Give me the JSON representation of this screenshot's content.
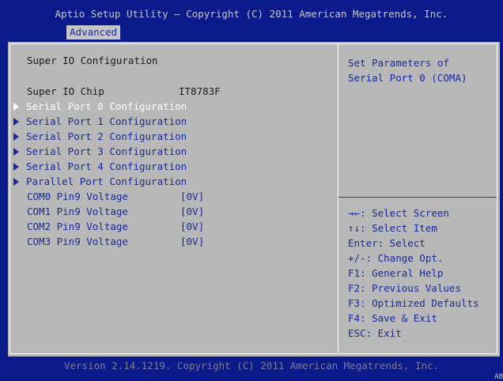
{
  "header": {
    "title": "Aptio Setup Utility – Copyright (C) 2011 American Megatrends, Inc.",
    "tab": "Advanced"
  },
  "main": {
    "title": "Super IO Configuration",
    "chip_label": "Super IO Chip",
    "chip_value": "IT8783F",
    "menu_items": [
      "Serial Port 0 Configuration",
      "Serial Port 1 Configuration",
      "Serial Port 2 Configuration",
      "Serial Port 3 Configuration",
      "Serial Port 4 Configuration",
      "Parallel Port Configuration"
    ],
    "settings": [
      {
        "label": "COM0 Pin9 Voltage",
        "value": "[0V]"
      },
      {
        "label": "COM1 Pin9 Voltage",
        "value": "[0V]"
      },
      {
        "label": "COM2 Pin9 Voltage",
        "value": "[0V]"
      },
      {
        "label": "COM3 Pin9 Voltage",
        "value": "[0V]"
      }
    ]
  },
  "help": {
    "lines": [
      "Set Parameters of",
      "Serial Port 0 (COMA)"
    ]
  },
  "keys": [
    "→←: Select Screen",
    "↑↓: Select Item",
    "Enter: Select",
    "+/-: Change Opt.",
    "F1: General Help",
    "F2: Previous Values",
    "F3: Optimized Defaults",
    "F4: Save & Exit",
    "ESC: Exit"
  ],
  "footer": {
    "text": "Version 2.14.1219. Copyright (C) 2011 American Megatrends, Inc.",
    "corner": "AB"
  },
  "colors": {
    "background": "#0a1a8a",
    "panel": "#b8b8b8",
    "menu_text": "#1a2a9a",
    "selected_text": "#ffffff"
  }
}
